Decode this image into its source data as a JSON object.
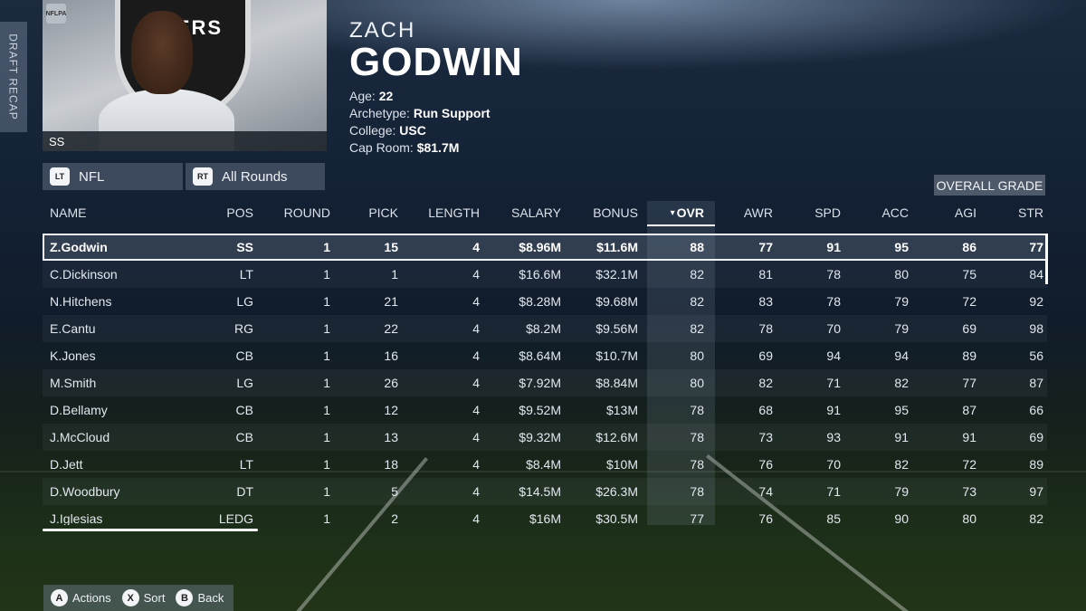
{
  "side_tab": {
    "label": "DRAFT RECAP"
  },
  "portrait": {
    "position": "SS",
    "logo_text": "ADERS",
    "badge": "NFLPA"
  },
  "player": {
    "first_name": "ZACH",
    "last_name": "GODWIN",
    "age_label": "Age:",
    "age": "22",
    "archetype_label": "Archetype:",
    "archetype": "Run Support",
    "college_label": "College:",
    "college": "USC",
    "cap_label": "Cap Room:",
    "cap_room": "$81.7M"
  },
  "filters": [
    {
      "button": "LT",
      "label": "NFL"
    },
    {
      "button": "RT",
      "label": "All Rounds"
    }
  ],
  "grade_button": "OVERALL GRADE",
  "table": {
    "sorted_column": "OVR",
    "headers": [
      "NAME",
      "POS",
      "ROUND",
      "PICK",
      "LENGTH",
      "SALARY",
      "BONUS",
      "OVR",
      "AWR",
      "SPD",
      "ACC",
      "AGI",
      "STR"
    ],
    "rows": [
      [
        "Z.Godwin",
        "SS",
        "1",
        "15",
        "4",
        "$8.96M",
        "$11.6M",
        "88",
        "77",
        "91",
        "95",
        "86",
        "77"
      ],
      [
        "C.Dickinson",
        "LT",
        "1",
        "1",
        "4",
        "$16.6M",
        "$32.1M",
        "82",
        "81",
        "78",
        "80",
        "75",
        "84"
      ],
      [
        "N.Hitchens",
        "LG",
        "1",
        "21",
        "4",
        "$8.28M",
        "$9.68M",
        "82",
        "83",
        "78",
        "79",
        "72",
        "92"
      ],
      [
        "E.Cantu",
        "RG",
        "1",
        "22",
        "4",
        "$8.2M",
        "$9.56M",
        "82",
        "78",
        "70",
        "79",
        "69",
        "98"
      ],
      [
        "K.Jones",
        "CB",
        "1",
        "16",
        "4",
        "$8.64M",
        "$10.7M",
        "80",
        "69",
        "94",
        "94",
        "89",
        "56"
      ],
      [
        "M.Smith",
        "LG",
        "1",
        "26",
        "4",
        "$7.92M",
        "$8.84M",
        "80",
        "82",
        "71",
        "82",
        "77",
        "87"
      ],
      [
        "D.Bellamy",
        "CB",
        "1",
        "12",
        "4",
        "$9.52M",
        "$13M",
        "78",
        "68",
        "91",
        "95",
        "87",
        "66"
      ],
      [
        "J.McCloud",
        "CB",
        "1",
        "13",
        "4",
        "$9.32M",
        "$12.6M",
        "78",
        "73",
        "93",
        "91",
        "91",
        "69"
      ],
      [
        "D.Jett",
        "LT",
        "1",
        "18",
        "4",
        "$8.4M",
        "$10M",
        "78",
        "76",
        "70",
        "82",
        "72",
        "89"
      ],
      [
        "D.Woodbury",
        "DT",
        "1",
        "5",
        "4",
        "$14.5M",
        "$26.3M",
        "78",
        "74",
        "71",
        "79",
        "73",
        "97"
      ],
      [
        "J.Iglesias",
        "LEDG",
        "1",
        "2",
        "4",
        "$16M",
        "$30.5M",
        "77",
        "76",
        "85",
        "90",
        "80",
        "82"
      ]
    ]
  },
  "legend": [
    {
      "button": "A",
      "label": "Actions"
    },
    {
      "button": "X",
      "label": "Sort"
    },
    {
      "button": "B",
      "label": "Back"
    }
  ]
}
